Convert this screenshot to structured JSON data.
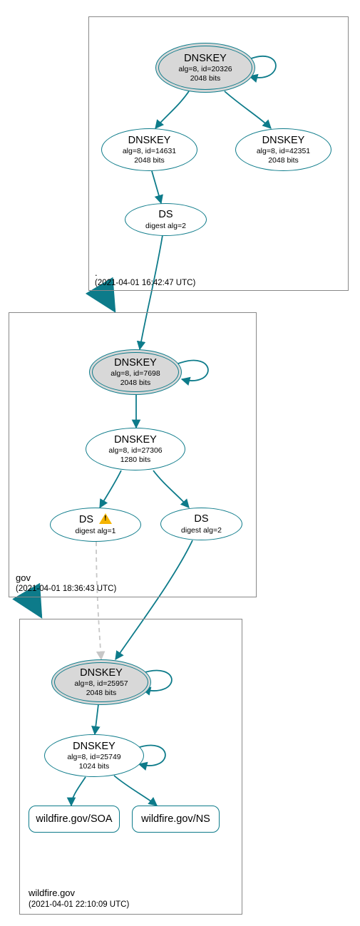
{
  "zones": {
    "root": {
      "label": ".",
      "timestamp": "(2021-04-01 16:42:47 UTC)",
      "nodes": {
        "ksk": {
          "title": "DNSKEY",
          "l1": "alg=8, id=20326",
          "l2": "2048 bits"
        },
        "zsk1": {
          "title": "DNSKEY",
          "l1": "alg=8, id=14631",
          "l2": "2048 bits"
        },
        "zsk2": {
          "title": "DNSKEY",
          "l1": "alg=8, id=42351",
          "l2": "2048 bits"
        },
        "ds": {
          "title": "DS",
          "l1": "digest alg=2"
        }
      }
    },
    "gov": {
      "label": "gov",
      "timestamp": "(2021-04-01 18:36:43 UTC)",
      "nodes": {
        "ksk": {
          "title": "DNSKEY",
          "l1": "alg=8, id=7698",
          "l2": "2048 bits"
        },
        "zsk": {
          "title": "DNSKEY",
          "l1": "alg=8, id=27306",
          "l2": "1280 bits"
        },
        "ds1": {
          "title": "DS",
          "l1": "digest alg=1",
          "warn": true
        },
        "ds2": {
          "title": "DS",
          "l1": "digest alg=2"
        }
      }
    },
    "wildfire": {
      "label": "wildfire.gov",
      "timestamp": "(2021-04-01 22:10:09 UTC)",
      "nodes": {
        "ksk": {
          "title": "DNSKEY",
          "l1": "alg=8, id=25957",
          "l2": "2048 bits"
        },
        "zsk": {
          "title": "DNSKEY",
          "l1": "alg=8, id=25749",
          "l2": "1024 bits"
        },
        "soa": {
          "label": "wildfire.gov/SOA"
        },
        "ns": {
          "label": "wildfire.gov/NS"
        }
      }
    }
  }
}
